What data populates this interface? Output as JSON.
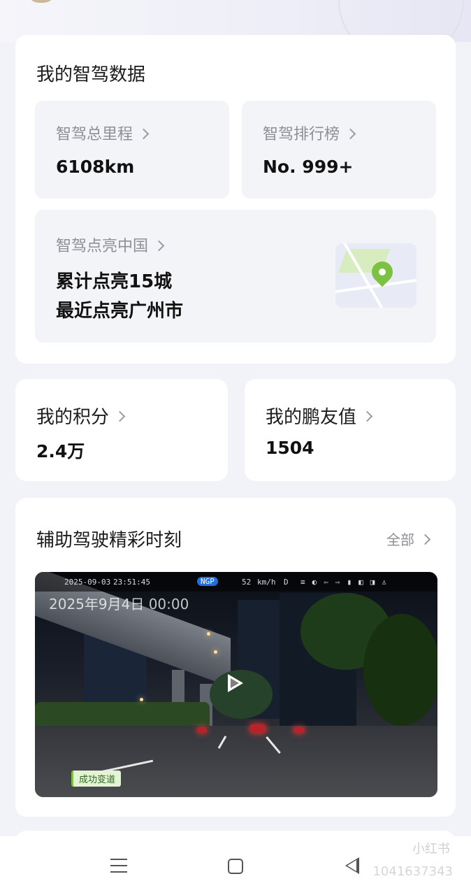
{
  "driving_data": {
    "title": "我的智驾数据",
    "mileage": {
      "label": "智驾总里程",
      "value": "6108km"
    },
    "ranking": {
      "label": "智驾排行榜",
      "value": "No. 999+"
    },
    "cities": {
      "label": "智驾点亮中国",
      "line1": "累计点亮15城",
      "line2": "最近点亮广州市",
      "icon": "map-pin-icon"
    }
  },
  "points": {
    "label": "我的积分",
    "value": "2.4万"
  },
  "friend_value": {
    "label": "我的鹏友值",
    "value": "1504"
  },
  "highlights": {
    "title": "辅助驾驶精彩时刻",
    "all_label": "全部",
    "video": {
      "hud_date": "2025-09-03",
      "hud_time": "23:51:45",
      "hud_mode": "NGP",
      "hud_speed": "52",
      "hud_unit": "km/h",
      "hud_gear": "D",
      "timestamp": "2025年9月4日 00:00",
      "tag": "成功变道"
    }
  },
  "watermark": {
    "brand": "小红书",
    "id": "1041637343"
  },
  "colors": {
    "accent_green": "#7cc142",
    "ngp_blue": "#1f6fe0",
    "background": "#f2f3f8"
  }
}
